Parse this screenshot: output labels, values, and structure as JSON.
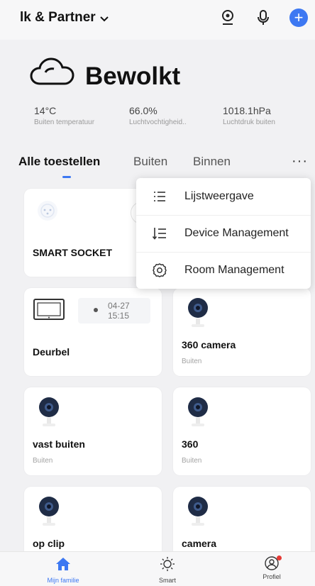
{
  "header": {
    "home_name": "lk & Partner",
    "accent_color": "#3d78f2"
  },
  "weather": {
    "condition": "Bewolkt",
    "metrics": [
      {
        "value": "14°C",
        "label": "Buiten temperatuur"
      },
      {
        "value": "66.0%",
        "label": "Luchtvochtigheid.."
      },
      {
        "value": "1018.1hPa",
        "label": "Luchtdruk buiten"
      }
    ]
  },
  "tabs": [
    "Alle toestellen",
    "Buiten",
    "Binnen"
  ],
  "more_label": "···",
  "menu": {
    "items": [
      {
        "label": "Lijstweergave",
        "icon": "list-icon"
      },
      {
        "label": "Device Management",
        "icon": "sort-list-icon"
      },
      {
        "label": "Room Management",
        "icon": "settings-icon"
      }
    ]
  },
  "devices": {
    "smart_socket": {
      "name": "SMART SOCKET"
    },
    "doorbell": {
      "name": "Deurbel",
      "event_date": "04-27",
      "event_time": "15:15"
    },
    "cameras": [
      {
        "name": "360 camera",
        "room": "Buiten"
      },
      {
        "name": "vast buiten",
        "room": "Buiten"
      },
      {
        "name": "360",
        "room": "Buiten"
      },
      {
        "name": "op clip",
        "room": ""
      },
      {
        "name": "camera",
        "room": ""
      }
    ]
  },
  "bottom_nav": [
    {
      "label": "Mijn familie",
      "icon": "home-icon",
      "active": true
    },
    {
      "label": "Smart",
      "icon": "sun-icon",
      "active": false
    },
    {
      "label": "Profiel",
      "icon": "profile-icon",
      "active": false
    }
  ]
}
